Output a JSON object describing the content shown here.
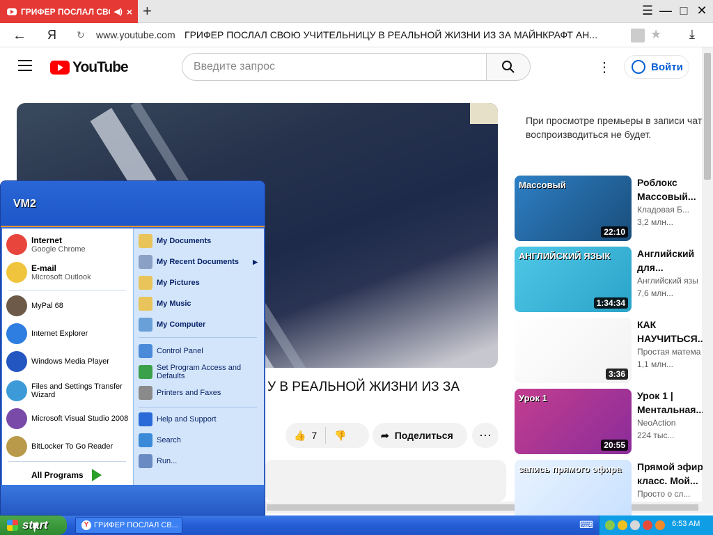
{
  "browser": {
    "tab_title": "ГРИФЕР ПОСЛАЛ СВОЮ",
    "new_tab": "+",
    "url": "www.youtube.com",
    "page_title": "ГРИФЕР ПОСЛАЛ СВОЮ УЧИТЕЛЬНИЦУ В РЕАЛЬНОЙ ЖИЗНИ ИЗ ЗА МАЙНКРАФТ АН...",
    "ya_label": "Я"
  },
  "youtube": {
    "logo_text": "YouTube",
    "search_placeholder": "Введите запрос",
    "login_label": "Войти",
    "video_title_visible": "У В РЕАЛЬНОЙ ЖИЗНИ ИЗ ЗА",
    "likes": "7",
    "share_label": "Поделиться",
    "premiere_line1": "При просмотре премьеры в записи чат",
    "premiere_line2": "воспроизводиться не будет.",
    "recommendations": [
      {
        "title1": "Роблокс",
        "title2": "Массовый...",
        "channel": "Кладовая Б...",
        "views": "3,2 млн...",
        "duration": "22:10",
        "thumb_text": "Массовый",
        "colors": [
          "#2d7fc4",
          "#1a4d7a"
        ]
      },
      {
        "title1": "Английский",
        "title2": "для...",
        "channel": "Английский язы",
        "views": "7,6 млн...",
        "duration": "1:34:34",
        "thumb_text": "АНГЛИЙСКИЙ ЯЗЫК",
        "colors": [
          "#4fc7e6",
          "#2aa3c9"
        ]
      },
      {
        "title1": "КАК",
        "title2": "НАУЧИТЬСЯ...",
        "channel": "Простая матема",
        "views": "1,1 млн...",
        "duration": "3:36",
        "thumb_text": "",
        "colors": [
          "#ffffff",
          "#f2f2f2"
        ]
      },
      {
        "title1": "Урок 1 |",
        "title2": "Ментальная...",
        "channel": "NeoAction",
        "views": "224 тыс...",
        "duration": "20:55",
        "thumb_text": "Урок 1",
        "colors": [
          "#c33d8f",
          "#8a2d9a"
        ]
      },
      {
        "title1": "Прямой эфир",
        "title2": "класс. Мой...",
        "channel": "Просто о сл...",
        "views": "",
        "duration": "",
        "thumb_text": "запись прямого эфира",
        "colors": [
          "#e9f3ff",
          "#c7e0ff"
        ]
      }
    ]
  },
  "start_menu": {
    "user": "VM2",
    "left_items": [
      {
        "name": "Internet",
        "sub": "Google Chrome",
        "bold": true,
        "color": "#e8453c"
      },
      {
        "name": "E-mail",
        "sub": "Microsoft Outlook",
        "bold": true,
        "color": "#f0c43c"
      },
      {
        "name": "MyPal 68",
        "sub": "",
        "bold": false,
        "color": "#6d5a48"
      },
      {
        "name": "Internet Explorer",
        "sub": "",
        "bold": false,
        "color": "#2e7de0"
      },
      {
        "name": "Windows Media Player",
        "sub": "",
        "bold": false,
        "color": "#2456c2"
      },
      {
        "name": "Files and Settings Transfer Wizard",
        "sub": "",
        "bold": false,
        "color": "#3c9ad8"
      },
      {
        "name": "Microsoft Visual Studio 2008",
        "sub": "",
        "bold": false,
        "color": "#7a4aa8"
      },
      {
        "name": "BitLocker To Go Reader",
        "sub": "",
        "bold": false,
        "color": "#b99a4a"
      }
    ],
    "all_programs": "All Programs",
    "right_items": [
      {
        "name": "My Documents",
        "bold": true,
        "color": "#e8c45a"
      },
      {
        "name": "My Recent Documents",
        "bold": true,
        "color": "#8aa0c4"
      },
      {
        "name": "My Pictures",
        "bold": true,
        "color": "#e8c45a"
      },
      {
        "name": "My Music",
        "bold": true,
        "color": "#e8c45a"
      },
      {
        "name": "My Computer",
        "bold": true,
        "color": "#6aa0d8"
      },
      {
        "name": "Control Panel",
        "bold": false,
        "color": "#4a8ad8"
      },
      {
        "name": "Set Program Access and Defaults",
        "bold": false,
        "color": "#3aa04a"
      },
      {
        "name": "Printers and Faxes",
        "bold": false,
        "color": "#8a8a8a"
      },
      {
        "name": "Help and Support",
        "bold": false,
        "color": "#2a6ad8"
      },
      {
        "name": "Search",
        "bold": false,
        "color": "#3a8ad8"
      },
      {
        "name": "Run...",
        "bold": false,
        "color": "#6a8ac4"
      }
    ]
  },
  "taskbar": {
    "start_label": "start",
    "task_title": "ГРИФЕР ПОСЛАЛ СВ...",
    "clock": "6:53 AM"
  }
}
